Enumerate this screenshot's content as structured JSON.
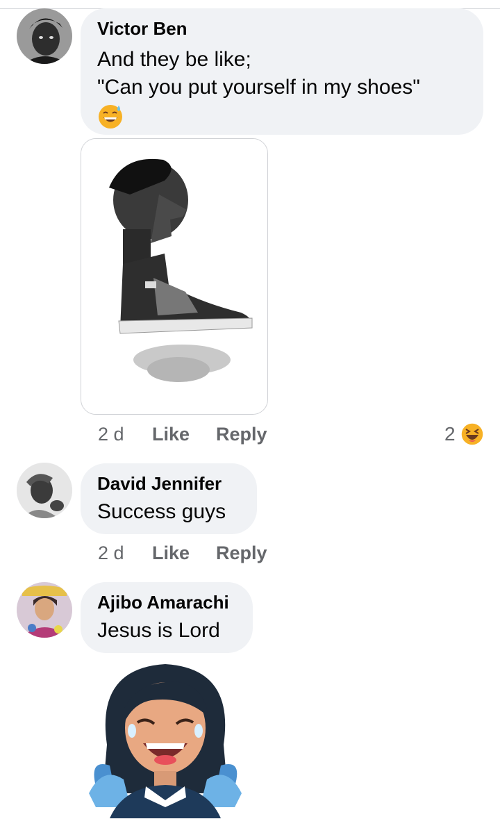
{
  "comments": [
    {
      "author": "Victor Ben",
      "lines": [
        "And they be like;",
        "\"Can you put yourself in my shoes\""
      ],
      "emoji": "grinning-sweat-emoji",
      "attachment": "image-head-on-sneaker",
      "time": "2 d",
      "like_label": "Like",
      "reply_label": "Reply",
      "reaction_count": "2",
      "reaction_icon": "laughing-squint-emoji"
    },
    {
      "author": "David Jennifer",
      "lines": [
        "Success guys"
      ],
      "time": "2 d",
      "like_label": "Like",
      "reply_label": "Reply"
    },
    {
      "author": "Ajibo Amarachi",
      "lines": [
        "Jesus is Lord"
      ],
      "sticker": "laughing-girl-sticker"
    }
  ],
  "colors": {
    "bubble": "#f0f2f5",
    "meta_text": "#65676b",
    "reaction_yellow": "#f7b125"
  }
}
